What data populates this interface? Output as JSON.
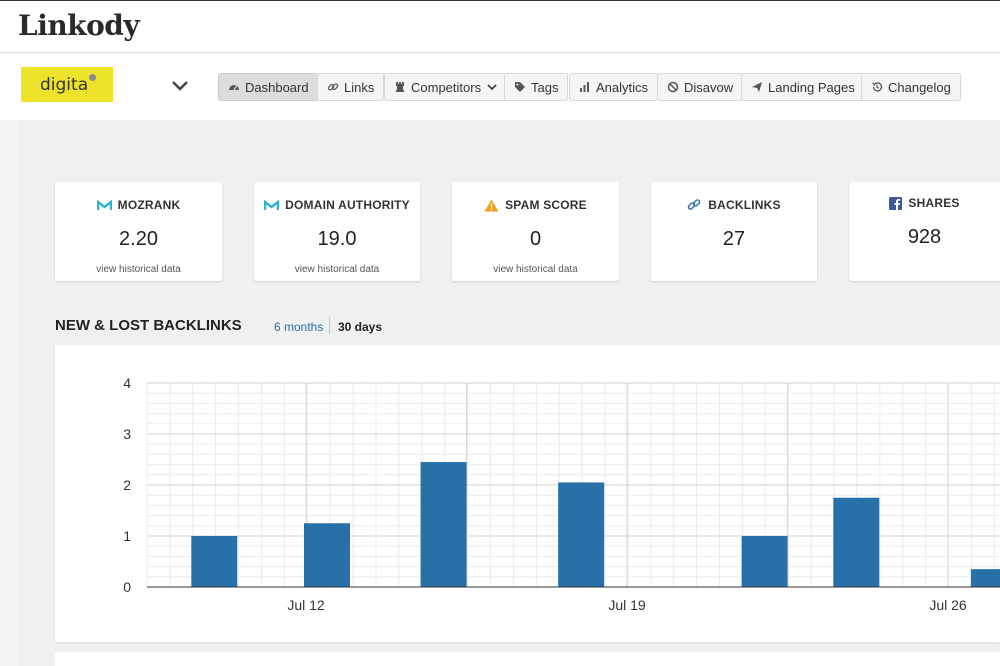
{
  "app": {
    "name": "Linkody"
  },
  "project": {
    "logo_text": "digita"
  },
  "nav": {
    "dashboard": "Dashboard",
    "links": "Links",
    "competitors": "Competitors",
    "tags": "Tags",
    "analytics": "Analytics",
    "disavow": "Disavow",
    "landing_pages": "Landing Pages",
    "changelog": "Changelog"
  },
  "metrics": {
    "mozrank": {
      "label": "MOZRANK",
      "value": "2.20",
      "link": "view historical data"
    },
    "domain_authority": {
      "label": "DOMAIN AUTHORITY",
      "value": "19.0",
      "link": "view historical data"
    },
    "spam_score": {
      "label": "SPAM SCORE",
      "value": "0",
      "link": "view historical data"
    },
    "backlinks": {
      "label": "BACKLINKS",
      "value": "27"
    },
    "shares": {
      "label": "SHARES",
      "value": "928"
    }
  },
  "backlinks_section": {
    "title": "NEW & LOST BACKLINKS",
    "range_6m": "6 months",
    "range_30d": "30 days"
  },
  "colors": {
    "bar": "#2871a8",
    "accent": "#2bb3c9",
    "link": "#2a6fa8",
    "project_bg": "#ede32a"
  },
  "chart_data": {
    "type": "bar",
    "x_ticks": [
      "Jul 12",
      "Jul 19",
      "Jul 26"
    ],
    "y_ticks": [
      0,
      1,
      2,
      3,
      4
    ],
    "ylim": [
      0,
      4
    ],
    "bars": [
      {
        "date": "Jul 10",
        "value": 1
      },
      {
        "date": "Jul 12",
        "value": 1.25
      },
      {
        "date": "Jul 15",
        "value": 2.45
      },
      {
        "date": "Jul 18",
        "value": 2.05
      },
      {
        "date": "Jul 22",
        "value": 1
      },
      {
        "date": "Jul 24",
        "value": 1.75
      },
      {
        "date": "Jul 27",
        "value": 0.35
      }
    ],
    "grid": true
  }
}
